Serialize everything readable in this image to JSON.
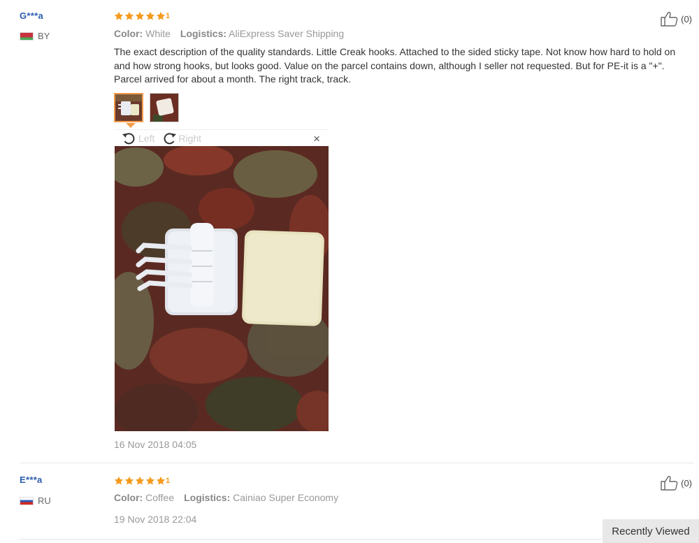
{
  "colors": {
    "star": "#f59a1e",
    "link": "#2a5db0",
    "thumb_selected": "#f39c4a"
  },
  "icons": [
    "star-icon",
    "thumbs-up-icon",
    "rotate-left-icon",
    "rotate-right-icon",
    "close-icon",
    "flag-icon"
  ],
  "reviews": [
    {
      "user": "G***a",
      "country": "BY",
      "rating_stars": 5,
      "color_label": "Color:",
      "color_value": "White",
      "logistics_label": "Logistics:",
      "logistics_value": "AliExpress Saver Shipping",
      "text": "The exact description of the quality standards. Little Creak hooks. Attached to the sided sticky tape. Not know how hard to hold on and how strong hooks, but looks good. Value on the parcel contains down, although I seller not requested. But for PE-it is a \"+\". Parcel arrived for about a month. The right track, track.",
      "helpful_count": "(0)",
      "viewer": {
        "rotate_left": "Left",
        "rotate_right": "Right",
        "close": "×"
      },
      "date": "16 Nov 2018 04:05"
    },
    {
      "user": "E***a",
      "country": "RU",
      "rating_stars": 5,
      "color_label": "Color:",
      "color_value": "Coffee",
      "logistics_label": "Logistics:",
      "logistics_value": "Cainiao Super Economy",
      "helpful_count": "(0)",
      "date": "19 Nov 2018 22:04"
    }
  ],
  "recently_viewed": "Recently Viewed"
}
